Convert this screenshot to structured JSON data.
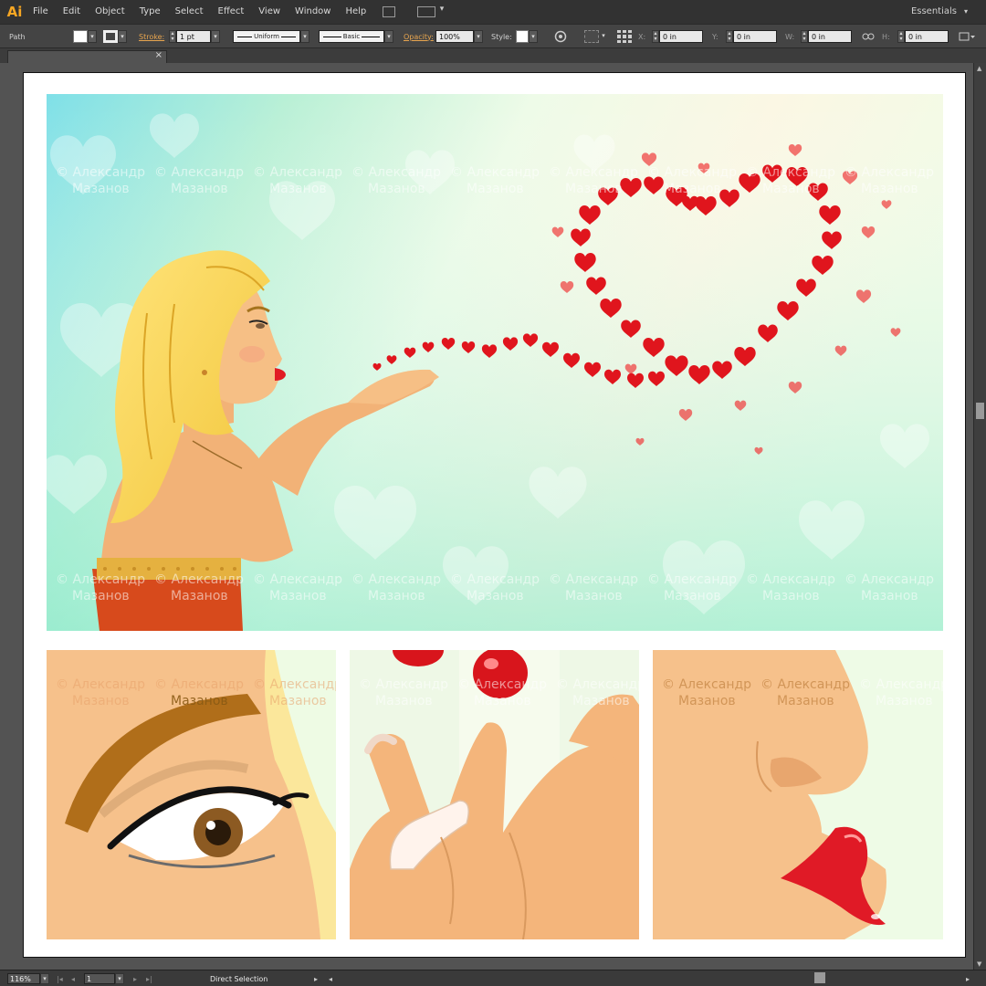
{
  "app": {
    "logo": "Ai",
    "accent": "#f6a623"
  },
  "menu": {
    "items": [
      "File",
      "Edit",
      "Object",
      "Type",
      "Select",
      "Effect",
      "View",
      "Window",
      "Help"
    ],
    "workspace": "Essentials"
  },
  "control": {
    "selection_type": "Path",
    "stroke_label": "Stroke:",
    "stroke_weight": "1 pt",
    "profile": "Uniform",
    "brush": "Basic",
    "opacity_label": "Opacity:",
    "opacity": "100%",
    "style_label": "Style:",
    "x_label": "X:",
    "x": "0 in",
    "y_label": "Y:",
    "y": "0 in",
    "w_label": "W:",
    "w": "0 in",
    "h_label": "H:",
    "h": "0 in"
  },
  "status": {
    "zoom": "116%",
    "artboard": "1",
    "tool": "Direct Selection"
  },
  "artwork": {
    "watermark_line1": "© Александр",
    "watermark_line2": "Мазанов"
  }
}
